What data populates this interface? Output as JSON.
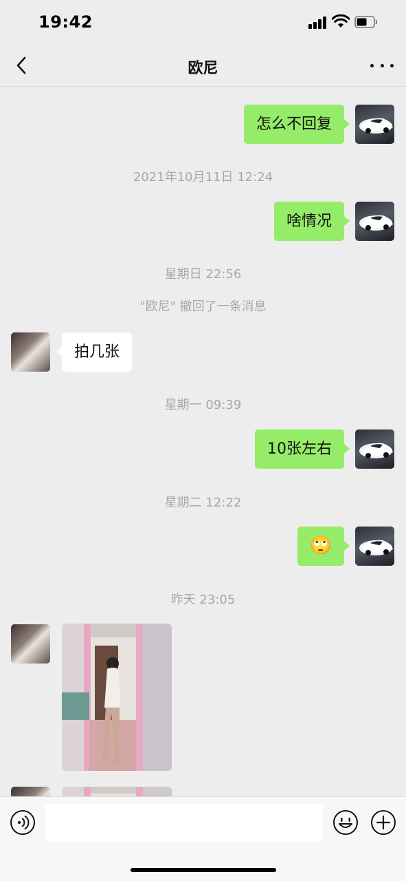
{
  "status_bar": {
    "time": "19:42"
  },
  "nav": {
    "title": "欧尼"
  },
  "messages": [
    {
      "side": "me",
      "text": "怎么不回复"
    },
    {
      "time": "2021年10月11日 12:24"
    },
    {
      "side": "me",
      "text": "啥情况"
    },
    {
      "time": "星期日 22:56"
    },
    {
      "system": "\"欧尼\" 撤回了一条消息"
    },
    {
      "side": "other",
      "text": "拍几张"
    },
    {
      "time": "星期一 09:39"
    },
    {
      "side": "me",
      "text": "10张左右"
    },
    {
      "time": "星期二 12:22"
    },
    {
      "side": "me",
      "emoji": "🙄"
    },
    {
      "time": "昨天 23:05"
    },
    {
      "side": "other",
      "image": "photo"
    },
    {
      "side": "other",
      "image": "photo"
    }
  ],
  "input_bar": {
    "placeholder": ""
  }
}
